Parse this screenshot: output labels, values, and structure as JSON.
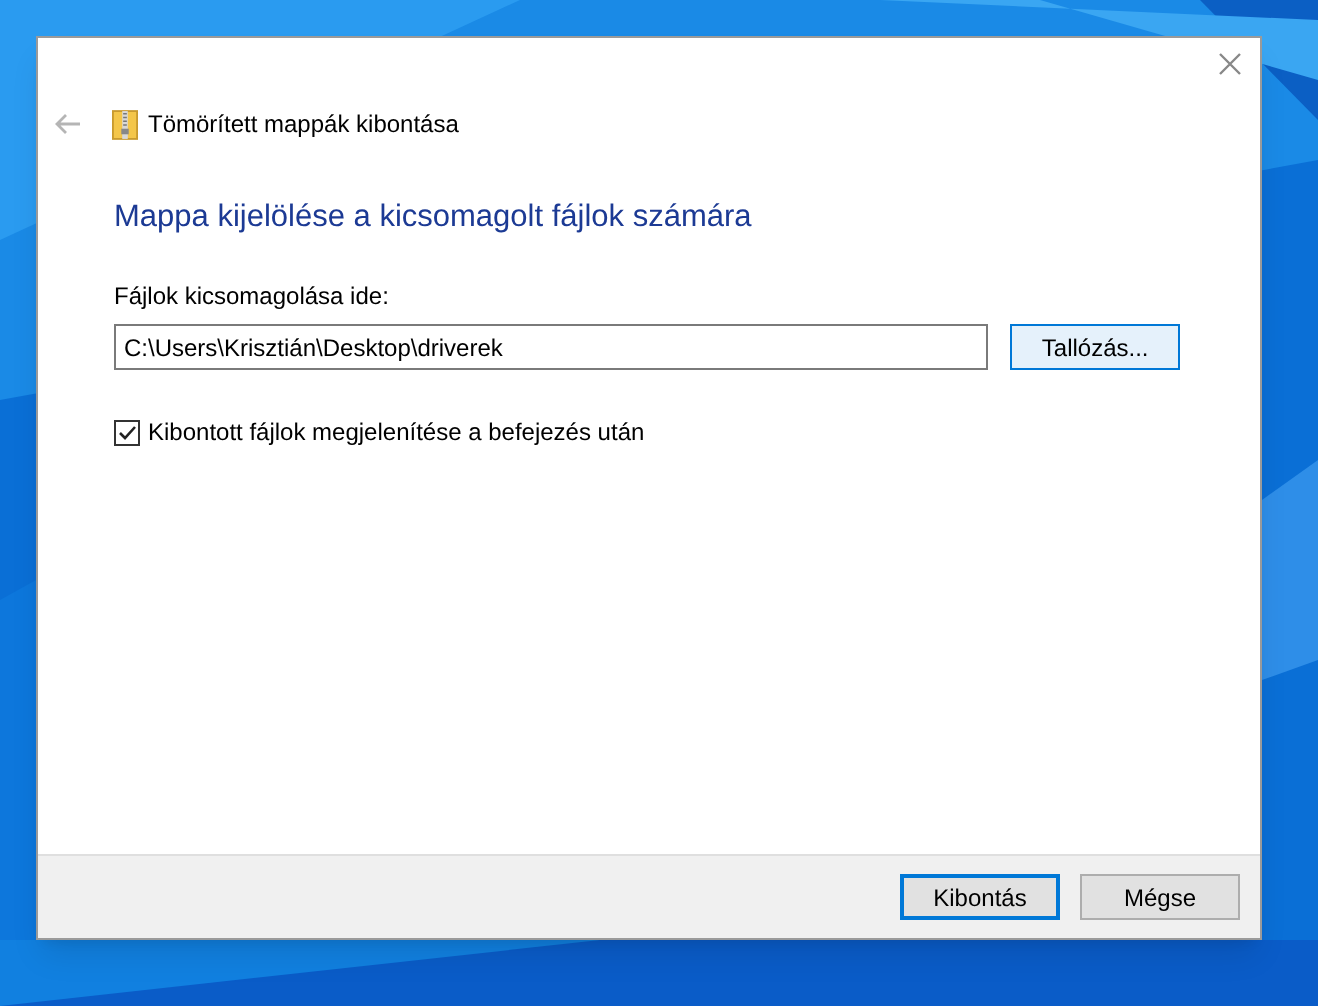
{
  "window": {
    "title": "Tömörített mappák kibontása"
  },
  "heading": "Mappa kijelölése a kicsomagolt fájlok számára",
  "destination": {
    "label": "Fájlok kicsomagolása ide:",
    "value": "C:\\Users\\Krisztián\\Desktop\\driverek",
    "browse": "Tallózás..."
  },
  "show_files": {
    "label": "Kibontott fájlok megjelenítése a befejezés után",
    "checked": true
  },
  "buttons": [
    {
      "label": "Kibontás",
      "default": true
    },
    {
      "label": "Mégse",
      "default": false
    }
  ]
}
